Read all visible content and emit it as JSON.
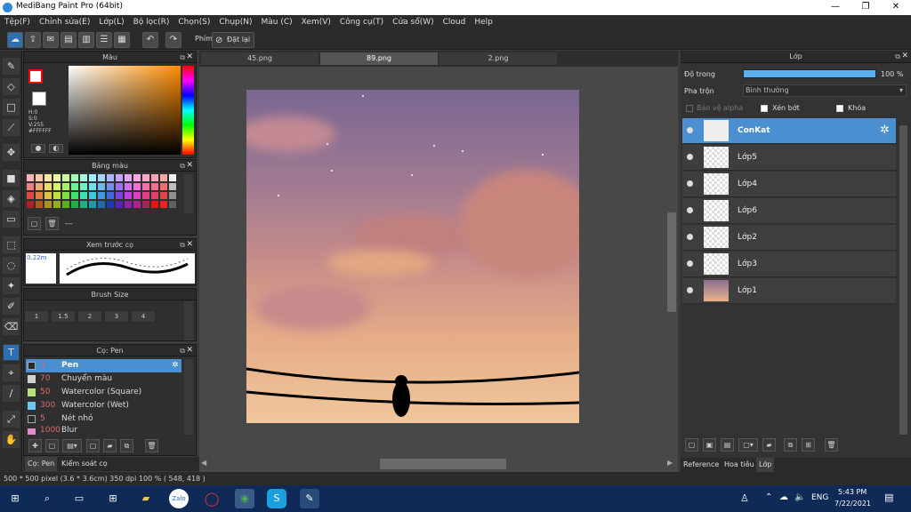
{
  "window": {
    "title": "MediBang Paint Pro (64bit)",
    "minimize": "—",
    "maximize": "❐",
    "close": "✕"
  },
  "menu": [
    "Tệp(F)",
    "Chỉnh sửa(E)",
    "Lớp(L)",
    "Bộ lọc(R)",
    "Chọn(S)",
    "Chụp(N)",
    "Màu (C)",
    "Xem(V)",
    "Công cụ(T)",
    "Cửa sổ(W)",
    "Cloud",
    "Help"
  ],
  "toolbar": {
    "shortcut_label": "Phím",
    "reset_label": "Đặt lại"
  },
  "color_panel": {
    "title": "Màu",
    "h": "H:0",
    "s": "S:0",
    "v": "V:255",
    "hex": "#FFFFFF"
  },
  "palette_panel": {
    "title": "Bảng màu",
    "name": "---"
  },
  "brush_preview": {
    "title": "Xem trước cọ",
    "size": "0.22m"
  },
  "brush_size": {
    "title": "Brush Size",
    "sizes": [
      "1",
      "1.5",
      "2",
      "3",
      "4"
    ]
  },
  "brush_panel": {
    "title": "Cọ: Pen",
    "items": [
      {
        "size": "3",
        "name": "Pen",
        "color": "#2a2a2a"
      },
      {
        "size": "70",
        "name": "Chuyển màu",
        "color": "#d0d0d0"
      },
      {
        "size": "50",
        "name": "Watercolor (Square)",
        "color": "#b8e07a"
      },
      {
        "size": "300",
        "name": "Watercolor (Wet)",
        "color": "#6ec5f0"
      },
      {
        "size": "5",
        "name": "Nét nhỏ",
        "color": "#2a2a2a"
      },
      {
        "size": "1000",
        "name": "Blur",
        "color": "#e88ad0"
      }
    ]
  },
  "bottom_tabs": {
    "left1": "Cọ: Pen",
    "left2": "Kiểm soát cọ",
    "right1": "Reference",
    "right2": "Hoa tiêu",
    "right3": "Lớp"
  },
  "canvas_tabs": [
    "45.png",
    "89.png",
    "2.png"
  ],
  "layer_panel": {
    "title": "Lớp",
    "opacity_label": "Độ trong",
    "opacity_value": "100 %",
    "blend_label": "Pha trộn",
    "blend_value": "Bình thường",
    "protect_alpha": "Bảo vệ alpha",
    "clip": "Xén bớt",
    "lock": "Khóa",
    "layers": [
      "ConKat",
      "Lớp5",
      "Lớp4",
      "Lớp6",
      "Lớp2",
      "Lớp3",
      "Lớp1"
    ]
  },
  "status": {
    "text": "500 * 500 pixel  (3.6 * 3.6cm)  350 dpi  100 %  ( 548, 418 )"
  },
  "taskbar": {
    "lang": "ENG",
    "time": "5:43 PM",
    "date": "7/22/2021"
  },
  "colors": {
    "accent": "#4a8fd0",
    "fg_swatch": "#ff0000",
    "bg_swatch": "#ffffff"
  }
}
